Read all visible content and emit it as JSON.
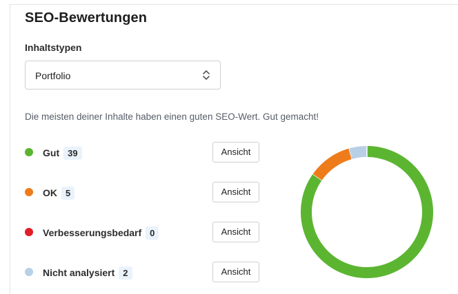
{
  "panel": {
    "title": "SEO-Bewertungen",
    "content_type_label": "Inhaltstypen",
    "content_type_value": "Portfolio",
    "summary": "Die meisten deiner Inhalte haben einen guten SEO-Wert. Gut gemacht!"
  },
  "ratings": [
    {
      "label": "Gut",
      "count": "39",
      "color": "#5cb531",
      "button": "Ansicht"
    },
    {
      "label": "OK",
      "count": "5",
      "color": "#ee7c1b",
      "button": "Ansicht"
    },
    {
      "label": "Verbesserungsbedarf",
      "count": "0",
      "color": "#e21d26",
      "button": "Ansicht"
    },
    {
      "label": "Nicht analysiert",
      "count": "2",
      "color": "#b8d0e6",
      "button": "Ansicht"
    }
  ],
  "icons": {
    "select_arrows": "chevron-up-down-icon"
  }
}
